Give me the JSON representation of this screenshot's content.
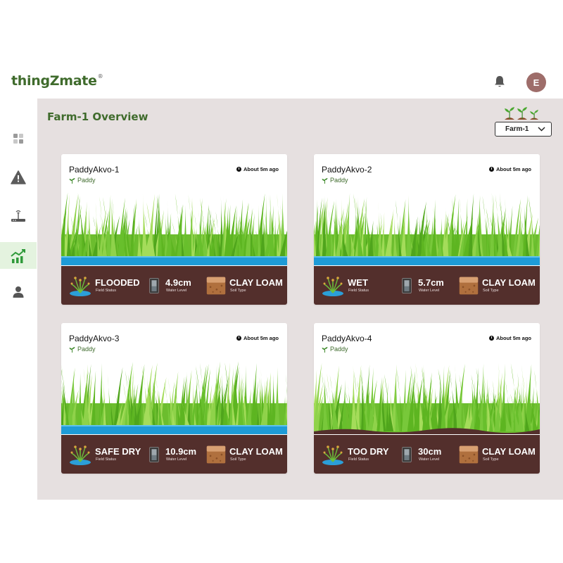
{
  "app": {
    "logo": "thingZmate",
    "logo_mark": "®",
    "avatar_initial": "E"
  },
  "colors": {
    "brand_green": "#3f6b2c",
    "panel_bg": "#e6e0e0",
    "status_bar": "#532f2c",
    "water": "#1e9bd7",
    "avatar": "#9e6d6a"
  },
  "sidebar": {
    "items": [
      {
        "icon": "dashboard-icon",
        "active": false
      },
      {
        "icon": "alert-icon",
        "active": false
      },
      {
        "icon": "gateway-icon",
        "active": false
      },
      {
        "icon": "analytics-icon",
        "active": true
      },
      {
        "icon": "user-icon",
        "active": false
      }
    ]
  },
  "main": {
    "title": "Farm-1 Overview",
    "farm_select": {
      "value": "Farm-1"
    }
  },
  "cards": [
    {
      "name": "PaddyAkvo-1",
      "crop": "Paddy",
      "time": "About 5m ago",
      "water_visible": true,
      "field_status": "FLOODED",
      "field_status_label": "Field Status",
      "water_level": "4.9cm",
      "water_level_label": "Water Level",
      "soil_type": "CLAY LOAM",
      "soil_type_label": "Soil Type"
    },
    {
      "name": "PaddyAkvo-2",
      "crop": "Paddy",
      "time": "About 5m ago",
      "water_visible": true,
      "field_status": "WET",
      "field_status_label": "Field Status",
      "water_level": "5.7cm",
      "water_level_label": "Water Level",
      "soil_type": "CLAY LOAM",
      "soil_type_label": "Soil Type"
    },
    {
      "name": "PaddyAkvo-3",
      "crop": "Paddy",
      "time": "About 5m ago",
      "water_visible": true,
      "field_status": "SAFE DRY",
      "field_status_label": "Field Status",
      "water_level": "10.9cm",
      "water_level_label": "Water Level",
      "soil_type": "CLAY LOAM",
      "soil_type_label": "Soil Type"
    },
    {
      "name": "PaddyAkvo-4",
      "crop": "Paddy",
      "time": "About 5m ago",
      "water_visible": false,
      "field_status": "TOO DRY",
      "field_status_label": "Field Status",
      "water_level": "30cm",
      "water_level_label": "Water Level",
      "soil_type": "CLAY LOAM",
      "soil_type_label": "Soil Type"
    }
  ]
}
